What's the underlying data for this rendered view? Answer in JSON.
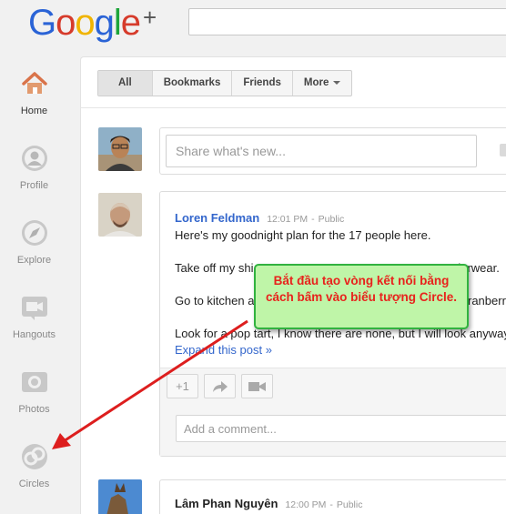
{
  "header": {
    "logo_text": "Google+",
    "search_placeholder": ""
  },
  "leftnav": {
    "items": [
      {
        "label": "Home",
        "icon": "home-icon",
        "active": true
      },
      {
        "label": "Profile",
        "icon": "profile-icon"
      },
      {
        "label": "Explore",
        "icon": "compass-icon"
      },
      {
        "label": "Hangouts",
        "icon": "video-camera-icon"
      },
      {
        "label": "Photos",
        "icon": "camera-icon"
      },
      {
        "label": "Circles",
        "icon": "circles-icon"
      }
    ]
  },
  "stream": {
    "tabs": [
      {
        "label": "All",
        "active": true
      },
      {
        "label": "Bookmarks"
      },
      {
        "label": "Friends"
      },
      {
        "label": "More"
      }
    ],
    "share_placeholder": "Share what's new...",
    "posts": [
      {
        "author": "Loren Feldman",
        "time": "12:01 PM",
        "visibility": "Public",
        "lines": [
          "Here's my goodnight plan for the 17 people here.",
          "Take off my shi",
          "derwear.",
          "Go to kitchen a",
          "ranberry",
          "Look for a pop tart, I know there are none, but I will look anyway"
        ],
        "expand": "Expand this post »",
        "plus_one": "+1",
        "comment_placeholder": "Add a comment..."
      },
      {
        "author": "Lâm Phan Nguyên",
        "time": "12:00 PM",
        "visibility": "Public"
      }
    ]
  },
  "annotation": {
    "line1": "Bắt đầu tạo vòng kết nối bằng",
    "line2": "cách bấm vào biểu tượng Circle.",
    "text_color": "#e8221c",
    "bg_color": "#bff5a8",
    "arrow_color": "#dd1e1e"
  }
}
